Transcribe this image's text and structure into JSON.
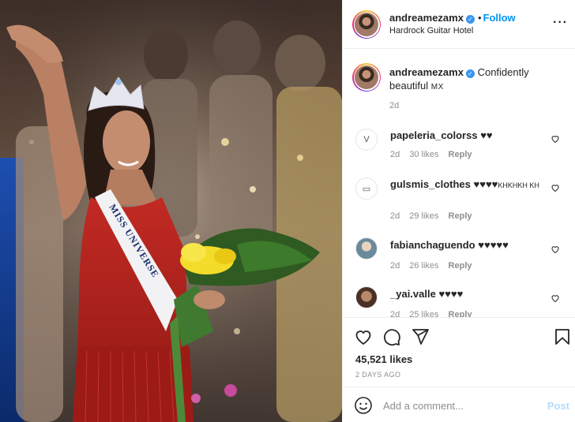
{
  "post": {
    "author": "andreamezamx",
    "location": "Hardrock Guitar Hotel",
    "follow_label": "Follow",
    "more_icon": "more-horizontal-icon",
    "photo_sash_text": "MISS UNIVERSE"
  },
  "caption": {
    "username": "andreamezamx",
    "text": "Confidently beautiful",
    "flag": "MX",
    "time": "2d"
  },
  "comments": [
    {
      "username": "papeleria_colorss",
      "text": "♥♥",
      "time": "2d",
      "likes": "30 likes",
      "reply": "Reply",
      "avatar_glyph": "V"
    },
    {
      "username": "gulsmis_clothes",
      "text": "♥♥♥♥",
      "extra": "KHKHKH KH",
      "time": "2d",
      "likes": "29 likes",
      "reply": "Reply",
      "avatar_glyph": "▭"
    },
    {
      "username": "fabianchaguendo",
      "text": "♥♥♥♥♥",
      "time": "2d",
      "likes": "26 likes",
      "reply": "Reply",
      "avatar_glyph": ""
    },
    {
      "username": "_yai.valle",
      "text": "♥♥♥♥",
      "time": "2d",
      "likes": "25 likes",
      "reply": "Reply",
      "avatar_glyph": ""
    }
  ],
  "actions": {
    "likes": "45,521 likes",
    "ago": "2 DAYS AGO"
  },
  "add_comment": {
    "placeholder": "Add a comment...",
    "post_label": "Post"
  },
  "colors": {
    "accent": "#0095f6",
    "verified": "#3897f0",
    "post_disabled": "#b3dbff",
    "dress": "#b0231e"
  }
}
